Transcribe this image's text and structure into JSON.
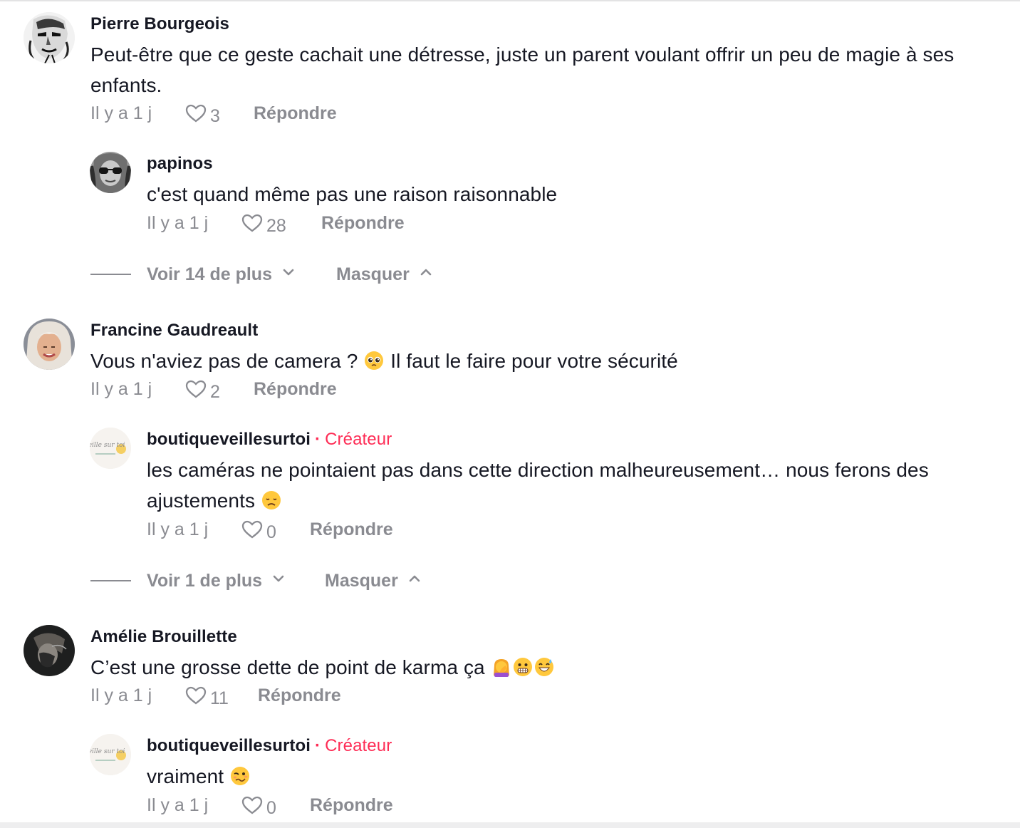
{
  "comments": [
    {
      "username": "Pierre Bourgeois",
      "text": "Peut-être que ce geste cachait une détresse, juste un parent voulant offrir un peu de magie à ses enfants.",
      "time": "Il y a 1 j",
      "likes": "3",
      "reply_label": "Répondre",
      "avatar": "black-white-face-avatar",
      "replies": [
        {
          "username": "papinos",
          "text": "c'est quand même pas une raison raisonnable",
          "time": "Il y a 1 j",
          "likes": "28",
          "reply_label": "Répondre",
          "avatar": "sunglasses-avatar"
        }
      ],
      "view_more": "Voir 14 de plus",
      "hide": "Masquer"
    },
    {
      "username": "Francine Gaudreault",
      "text_before": "Vous n'aviez pas de camera ?",
      "emoji_1": "pleading-face-emoji",
      "text_after": "Il faut le faire pour votre sécurité",
      "time": "Il y a 1 j",
      "likes": "2",
      "reply_label": "Répondre",
      "avatar": "blonde-woman-avatar",
      "replies": [
        {
          "username": "boutiqueveillesurtoi",
          "separator": "·",
          "creator": "Créateur",
          "text": "les caméras ne pointaient pas dans cette direction malheureusement… nous ferons des ajustements",
          "emoji": "disappointed-face-emoji",
          "time": "Il y a 1 j",
          "likes": "0",
          "reply_label": "Répondre",
          "avatar": "veille-sur-toi-logo-avatar",
          "avatar_text": "veille sur toi"
        }
      ],
      "view_more": "Voir 1 de plus",
      "hide": "Masquer"
    },
    {
      "username": "Amélie Brouillette",
      "text": "C’est une grosse dette de point de karma ça",
      "emojis": [
        "facepalm-woman-emoji",
        "grimacing-face-emoji",
        "grinning-sweat-emoji"
      ],
      "time": "Il y a 1 j",
      "likes": "11",
      "reply_label": "Répondre",
      "avatar": "dark-portrait-avatar",
      "replies": [
        {
          "username": "boutiqueveillesurtoi",
          "separator": "·",
          "creator": "Créateur",
          "text": "vraiment",
          "emoji": "woozy-face-emoji",
          "time": "Il y a 1 j",
          "likes": "0",
          "reply_label": "Répondre",
          "avatar": "veille-sur-toi-logo-avatar",
          "avatar_text": "veille sur toi"
        }
      ]
    }
  ],
  "colors": {
    "text": "#161823",
    "muted": "#8a8b91",
    "creator": "#fe2c55"
  }
}
